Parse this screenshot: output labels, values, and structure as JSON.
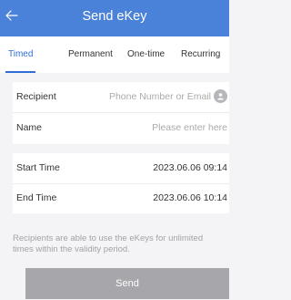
{
  "header": {
    "title": "Send eKey"
  },
  "tabs": [
    {
      "label": "Timed",
      "active": true
    },
    {
      "label": "Permanent"
    },
    {
      "label": "One-time"
    },
    {
      "label": "Recurring"
    }
  ],
  "form": {
    "recipient_label": "Recipient",
    "recipient_placeholder": "Phone Number or Email",
    "name_label": "Name",
    "name_placeholder": "Please enter here",
    "start_label": "Start Time",
    "start_value": "2023.06.06 09:14",
    "end_label": "End Time",
    "end_value": "2023.06.06 10:14"
  },
  "note": "Recipients are able to use the eKeys for unlimited times within the validity period.",
  "send_button": "Send",
  "colors": {
    "header": "#4b82d9",
    "accent": "#2f6fd6",
    "disabled_button": "#a6a6ab"
  },
  "icons": {
    "back": "arrow-left-icon",
    "contact": "contact-person-icon"
  }
}
